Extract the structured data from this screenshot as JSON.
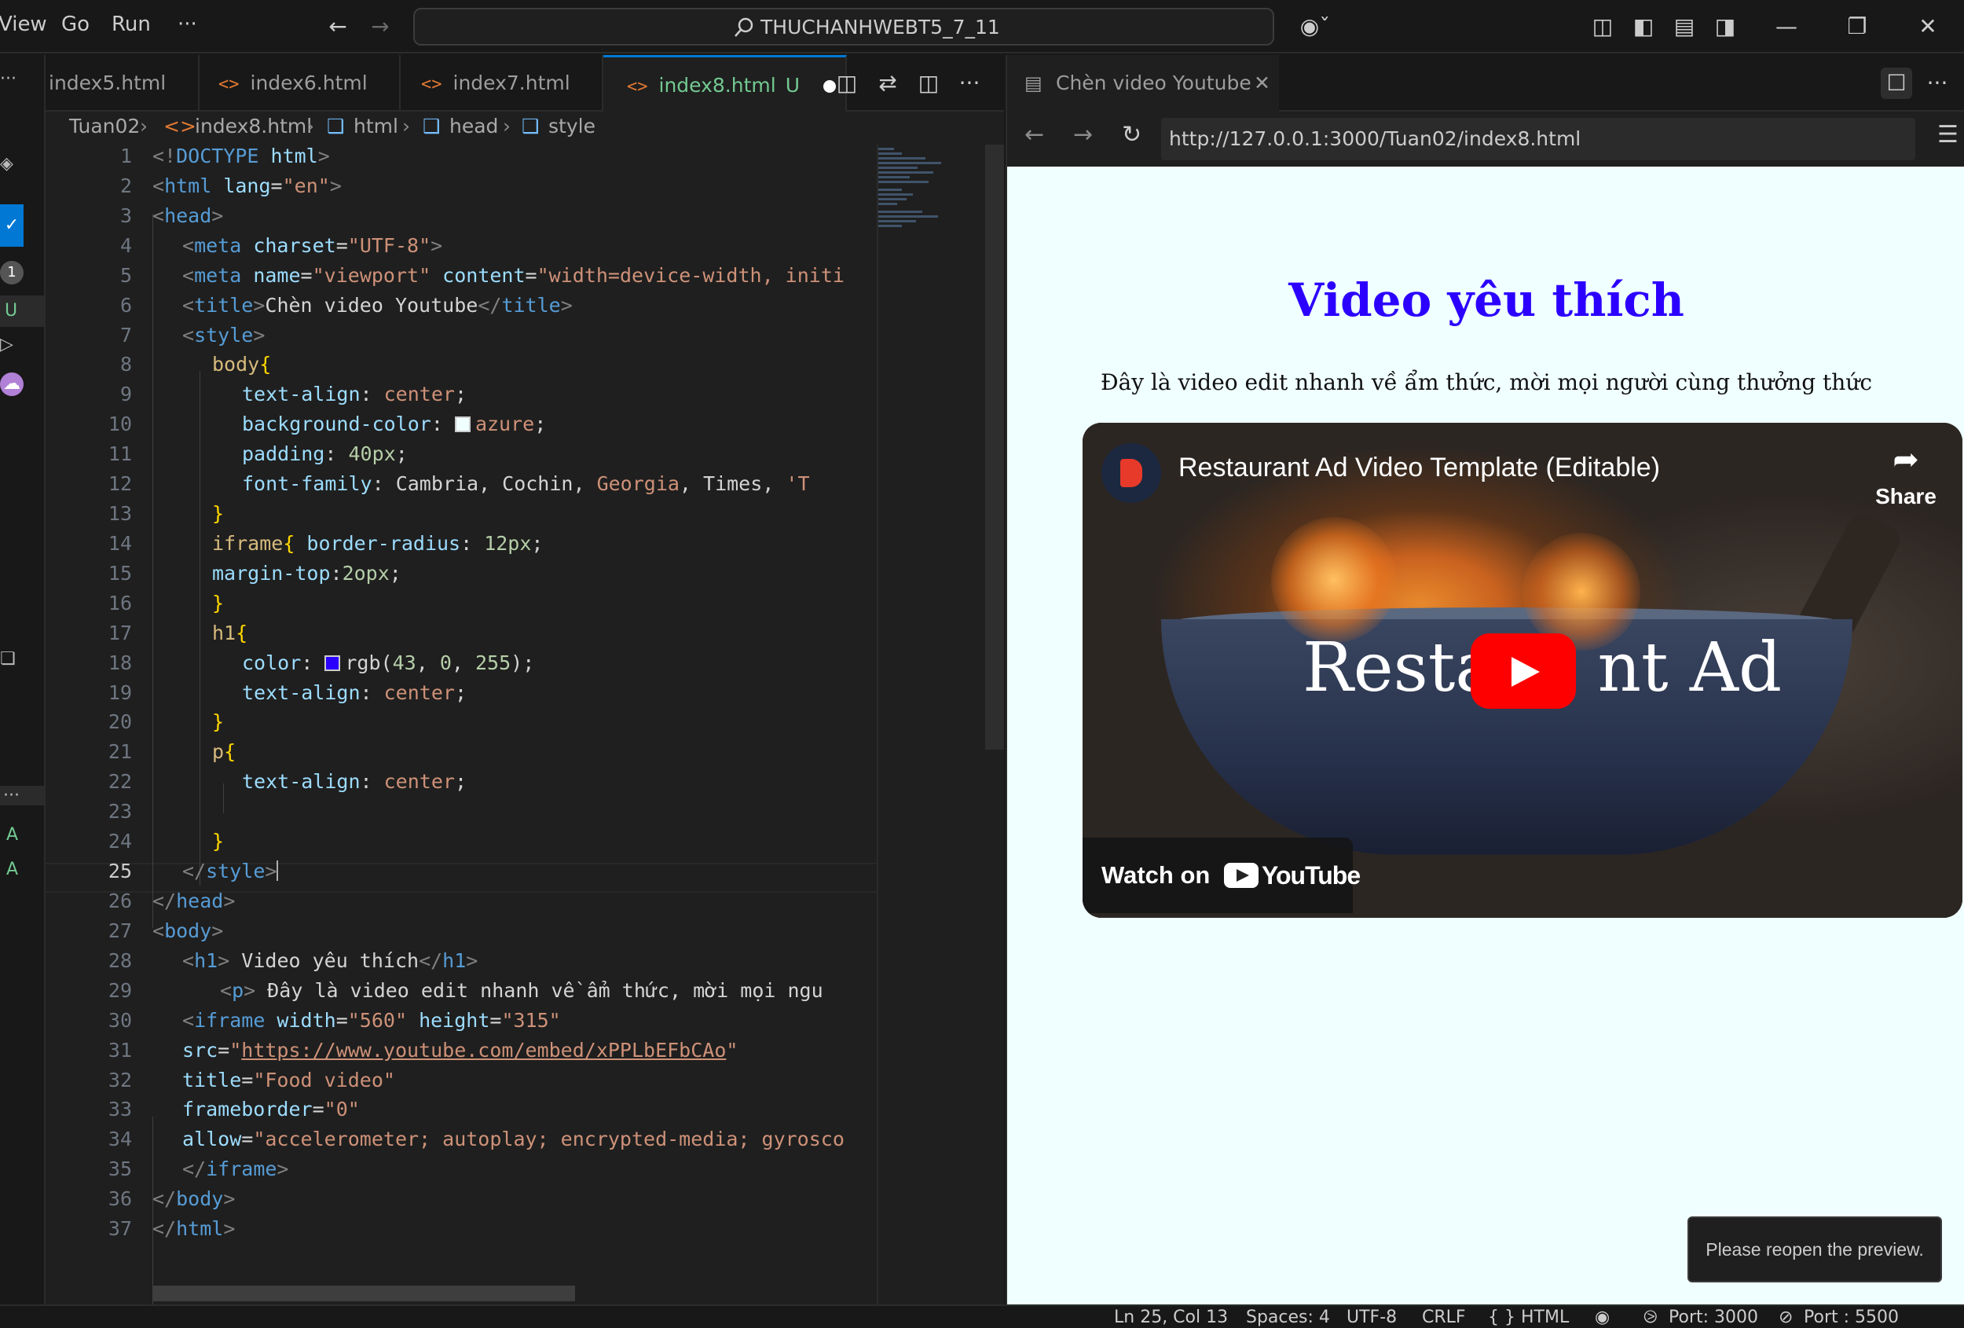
{
  "menu": [
    "View",
    "Go",
    "Run",
    "···"
  ],
  "command_center": "THUCHANHWEBT5_7_11",
  "tabs": [
    {
      "label": "index5.html",
      "icon": "html-icon",
      "active": false
    },
    {
      "label": "index6.html",
      "icon": "html-icon",
      "active": false
    },
    {
      "label": "index7.html",
      "icon": "html-icon",
      "active": false
    },
    {
      "label": "index8.html",
      "icon": "html-icon",
      "active": true,
      "status": "U"
    }
  ],
  "breadcrumb": [
    "Tuan02",
    "index8.html",
    "html",
    "head",
    "style"
  ],
  "activity_badges": {
    "count": "1",
    "untracked": "U"
  },
  "line_numbers": [
    "1",
    "2",
    "3",
    "4",
    "5",
    "6",
    "7",
    "8",
    "9",
    "10",
    "11",
    "12",
    "13",
    "14",
    "15",
    "16",
    "17",
    "18",
    "19",
    "20",
    "21",
    "22",
    "23",
    "24",
    "25",
    "26",
    "27",
    "28",
    "29",
    "30",
    "31",
    "32",
    "33",
    "34",
    "35",
    "36",
    "37"
  ],
  "code": {
    "l1": [
      "<!",
      "DOCTYPE",
      " html",
      ">"
    ],
    "l2": [
      "<",
      "html",
      " lang",
      "=",
      "\"en\"",
      ">"
    ],
    "l3": [
      "<",
      "head",
      ">"
    ],
    "l4": [
      "<",
      "meta",
      " charset",
      "=",
      "\"UTF-8\"",
      ">"
    ],
    "l5": [
      "<",
      "meta",
      " name",
      "=",
      "\"viewport\"",
      " content",
      "=",
      "\"width=device-width, initi"
    ],
    "l6": [
      "<",
      "title",
      ">",
      "Chèn video Youtube",
      "</",
      "title",
      ">"
    ],
    "l7": [
      "<",
      "style",
      ">"
    ],
    "l8": [
      "body",
      "{"
    ],
    "l9": [
      "text-align",
      ": ",
      "center",
      ";"
    ],
    "l10": [
      "background-color",
      ": ",
      "azure",
      ";"
    ],
    "l11": [
      "padding",
      ": ",
      "40px",
      ";"
    ],
    "l12": [
      "font-family",
      ": ",
      "Cambria, Cochin, ",
      "Georgia",
      ", ",
      "Times",
      ", ",
      "'T"
    ],
    "l13": [
      "}"
    ],
    "l14": [
      "iframe",
      "{",
      " border-radius",
      ": ",
      "12px",
      ";"
    ],
    "l15": [
      "margin-top",
      ":",
      "2opx",
      ";"
    ],
    "l16": [
      "}"
    ],
    "l17": [
      "h1",
      "{"
    ],
    "l18": [
      "color",
      ": ",
      "rgb(",
      "43",
      ", ",
      "0",
      ", ",
      "255",
      ");"
    ],
    "l19": [
      "text-align",
      ": ",
      "center",
      ";"
    ],
    "l20": [
      "}"
    ],
    "l21": [
      "p",
      "{"
    ],
    "l22": [
      "text-align",
      ": ",
      "center",
      ";"
    ],
    "l24": [
      "}"
    ],
    "l25": [
      "</",
      "style",
      ">"
    ],
    "l26": [
      "</",
      "head",
      ">"
    ],
    "l27": [
      "<",
      "body",
      ">"
    ],
    "l28": [
      "<",
      "h1",
      ">",
      " Video yêu thích",
      "</",
      "h1",
      ">"
    ],
    "l29": [
      "<",
      "p",
      ">",
      " Đây là video edit nhanh về ẩm thức, mời mọi ngu"
    ],
    "l30": [
      "<",
      "iframe",
      " width",
      "=",
      "\"560\"",
      " height",
      "=",
      "\"315\""
    ],
    "l31": [
      "src",
      "=",
      "\"",
      "https://www.youtube.com/embed/xPPLbEFbCAo",
      "\""
    ],
    "l32": [
      "title",
      "=",
      "\"Food video\""
    ],
    "l33": [
      "frameborder",
      "=",
      "\"0\""
    ],
    "l34": [
      "allow",
      "=",
      "\"accelerometer; autoplay; encrypted-media; gyrosco"
    ],
    "l35": [
      "</",
      "iframe",
      ">"
    ],
    "l36": [
      "</",
      "body",
      ">"
    ],
    "l37": [
      "</",
      "html",
      ">"
    ]
  },
  "colors": {
    "azure_swatch": "#f0ffff",
    "rgb_swatch": "#2b00ff",
    "h1_color": "#2b00ff",
    "accent": "#0078d4"
  },
  "preview": {
    "tab_title": "Chèn video Youtube",
    "url": "http://127.0.0.1:3000/Tuan02/index8.html",
    "h1": "Video yêu thích",
    "p": "Đây là video edit nhanh về ẩm thức, mời mọi người cùng thưởng thức",
    "video": {
      "title": "Restaurant Ad Video Template (Editable)",
      "share": "Share",
      "overlay_left": "Resta",
      "overlay_right": "nt Ad",
      "watch_on": "Watch on",
      "youtube": "YouTube"
    },
    "toast": "Please reopen the preview."
  },
  "status": {
    "position": "Ln 25, Col 13",
    "spaces": "Spaces: 4",
    "encoding": "UTF-8",
    "eol": "CRLF",
    "language": "{ } HTML",
    "port": "Port: 3000",
    "live_port": "Port : 5500"
  }
}
